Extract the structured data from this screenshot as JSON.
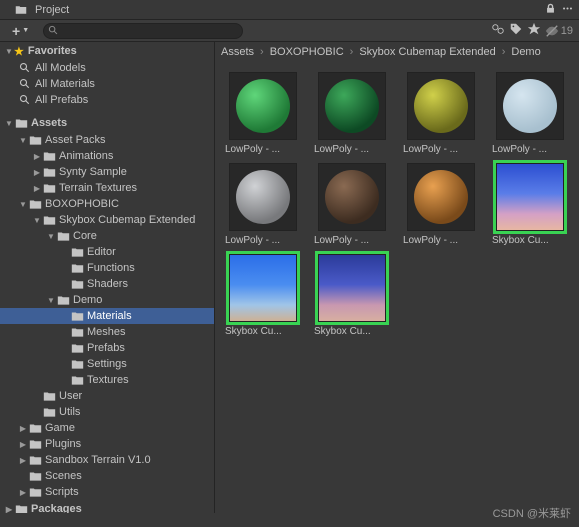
{
  "header": {
    "title": "Project",
    "hiddenCount": "19"
  },
  "search": {
    "placeholder": ""
  },
  "breadcrumb": [
    "Assets",
    "BOXOPHOBIC",
    "Skybox Cubemap Extended",
    "Demo"
  ],
  "favorites": {
    "label": "Favorites",
    "items": [
      "All Models",
      "All Materials",
      "All Prefabs"
    ]
  },
  "tree": {
    "label": "Assets",
    "packages": "Packages",
    "nodes": [
      {
        "indent": 1,
        "arrow": "down",
        "label": "Asset Packs"
      },
      {
        "indent": 2,
        "arrow": "right",
        "label": "Animations"
      },
      {
        "indent": 2,
        "arrow": "right",
        "label": "Synty Sample"
      },
      {
        "indent": 2,
        "arrow": "right",
        "label": "Terrain Textures"
      },
      {
        "indent": 1,
        "arrow": "down",
        "label": "BOXOPHOBIC"
      },
      {
        "indent": 2,
        "arrow": "down",
        "label": "Skybox Cubemap Extended"
      },
      {
        "indent": 3,
        "arrow": "down",
        "label": "Core"
      },
      {
        "indent": 4,
        "arrow": "",
        "label": "Editor"
      },
      {
        "indent": 4,
        "arrow": "",
        "label": "Functions"
      },
      {
        "indent": 4,
        "arrow": "",
        "label": "Shaders"
      },
      {
        "indent": 3,
        "arrow": "down",
        "label": "Demo"
      },
      {
        "indent": 4,
        "arrow": "",
        "label": "Materials",
        "selected": true
      },
      {
        "indent": 4,
        "arrow": "",
        "label": "Meshes"
      },
      {
        "indent": 4,
        "arrow": "",
        "label": "Prefabs"
      },
      {
        "indent": 4,
        "arrow": "",
        "label": "Settings"
      },
      {
        "indent": 4,
        "arrow": "",
        "label": "Textures"
      },
      {
        "indent": 2,
        "arrow": "",
        "label": "User"
      },
      {
        "indent": 2,
        "arrow": "",
        "label": "Utils"
      },
      {
        "indent": 1,
        "arrow": "right",
        "label": "Game"
      },
      {
        "indent": 1,
        "arrow": "right",
        "label": "Plugins"
      },
      {
        "indent": 1,
        "arrow": "right",
        "label": "Sandbox Terrain V1.0"
      },
      {
        "indent": 1,
        "arrow": "",
        "label": "Scenes"
      },
      {
        "indent": 1,
        "arrow": "right",
        "label": "Scripts"
      }
    ]
  },
  "assets": [
    {
      "label": "LowPoly - ...",
      "type": "sphere",
      "color": "radial-gradient(circle at 35% 30%, #5fd67a, #1f7a36 70%)"
    },
    {
      "label": "LowPoly - ...",
      "type": "sphere",
      "color": "radial-gradient(circle at 35% 30%, #3da85a, #0d4a24 70%)"
    },
    {
      "label": "LowPoly - ...",
      "type": "sphere",
      "color": "radial-gradient(circle at 35% 30%, #d0d04a, #6a6a1b 70%)"
    },
    {
      "label": "LowPoly - ...",
      "type": "sphere",
      "color": "radial-gradient(circle at 35% 30%, #d5e5ef, #a8c0cf 70%)"
    },
    {
      "label": "LowPoly - ...",
      "type": "sphere",
      "color": "radial-gradient(circle at 35% 30%, #d0d2d5, #78797c 70%)"
    },
    {
      "label": "LowPoly - ...",
      "type": "sphere",
      "color": "radial-gradient(circle at 35% 30%, #8a6a52, #3d2c20 70%)"
    },
    {
      "label": "LowPoly - ...",
      "type": "sphere",
      "color": "radial-gradient(circle at 35% 30%, #e8a050, #7a4a1a 70%)"
    },
    {
      "label": "Skybox Cu...",
      "type": "sky",
      "color": "linear-gradient(#2a4dd0 0%, #5a7de8 45%, #d4a0c5 75%, #e8b8a0 100%)",
      "highlight": true
    },
    {
      "label": "Skybox Cu...",
      "type": "sky",
      "color": "linear-gradient(#2a6de8 0%, #4a8df0 45%, #a0c5e8 75%, #d0b090 100%)",
      "highlight": true
    },
    {
      "label": "Skybox Cu...",
      "type": "sky",
      "color": "linear-gradient(#2a3a98 0%, #4a5ac8 45%, #c898b0 75%, #d8b0a0 100%)",
      "highlight": true
    }
  ],
  "watermark": "CSDN @米莱虾"
}
